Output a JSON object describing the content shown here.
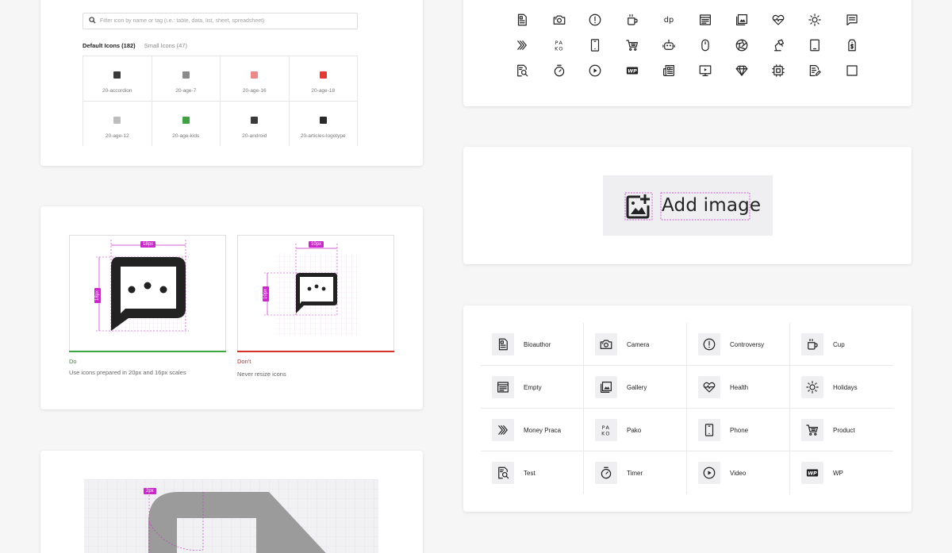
{
  "browser": {
    "search_placeholder": "Filter icon by name or tag (i.e.: table, data, list, sheet, spreadsheet)",
    "tabs": [
      {
        "label": "Default Icons (182)",
        "active": true
      },
      {
        "label": "Small Icons (47)",
        "active": false
      }
    ],
    "icons": [
      {
        "label": "20-accordion",
        "color": "#3a3a3a"
      },
      {
        "label": "20-age-7",
        "color": "#8a8a8a"
      },
      {
        "label": "20-age-16",
        "color": "#e88a8a"
      },
      {
        "label": "20-age-18",
        "color": "#e53935"
      },
      {
        "label": "20-age-12",
        "color": "#bdbdbd"
      },
      {
        "label": "20-age-kids",
        "color": "#43a047"
      },
      {
        "label": "20-android",
        "color": "#3a3a3a"
      },
      {
        "label": "20-articles-logotype",
        "color": "#2a2a2a"
      }
    ]
  },
  "do_dont": {
    "do": {
      "verdict": "Do",
      "note": "Use icons prepared in 20px and 16px scales",
      "width_tag": "18px",
      "height_tag": "18px"
    },
    "dont": {
      "verdict": "Don't",
      "note": "Never resize icons",
      "width_tag": "10px",
      "height_tag": "10px"
    }
  },
  "construction": {
    "radius_tag": "2px"
  },
  "icon_gallery": {
    "rows": [
      [
        "bioauthor-icon",
        "camera-icon",
        "controversy-icon",
        "cup-icon",
        "dp-logo-icon",
        "empty-icon",
        "gallery-icon",
        "health-icon",
        "holidays-icon",
        "comment-icon"
      ],
      [
        "money-praca-icon",
        "pako-icon",
        "phone-icon",
        "product-icon",
        "robot-icon",
        "mouse-icon",
        "aperture-icon",
        "desk-lamp-icon",
        "tablet-icon",
        "price-tag-icon"
      ],
      [
        "test-icon",
        "timer-icon",
        "video-icon",
        "wp-logo-icon",
        "newspaper-icon",
        "presentation-icon",
        "diamond-icon",
        "chip-icon",
        "edit-document-icon",
        "square-icon"
      ]
    ],
    "dp_text": "dp",
    "pako_text_top": "PA",
    "pako_text_bottom": "KO",
    "wp_text": "WP"
  },
  "add_image": {
    "label": "Add image"
  },
  "icon_table": {
    "items": [
      {
        "label": "Bioauthor",
        "icon": "bioauthor-icon"
      },
      {
        "label": "Camera",
        "icon": "camera-icon"
      },
      {
        "label": "Controversy",
        "icon": "controversy-icon"
      },
      {
        "label": "Cup",
        "icon": "cup-icon"
      },
      {
        "label": "Empty",
        "icon": "empty-icon"
      },
      {
        "label": "Gallery",
        "icon": "gallery-icon"
      },
      {
        "label": "Health",
        "icon": "health-icon"
      },
      {
        "label": "Holidays",
        "icon": "holidays-icon"
      },
      {
        "label": "Money Praca",
        "icon": "money-praca-icon"
      },
      {
        "label": "Pako",
        "icon": "pako-icon"
      },
      {
        "label": "Phone",
        "icon": "phone-icon"
      },
      {
        "label": "Product",
        "icon": "product-icon"
      },
      {
        "label": "Test",
        "icon": "test-icon"
      },
      {
        "label": "Timer",
        "icon": "timer-icon"
      },
      {
        "label": "Video",
        "icon": "video-icon"
      },
      {
        "label": "WP",
        "icon": "wp-logo-icon"
      }
    ]
  },
  "colors": {
    "guide_magenta": "#c829c8",
    "do_green": "#3ea63e",
    "dont_red": "#d93025",
    "icon_tile_bg": "#efeef1"
  }
}
